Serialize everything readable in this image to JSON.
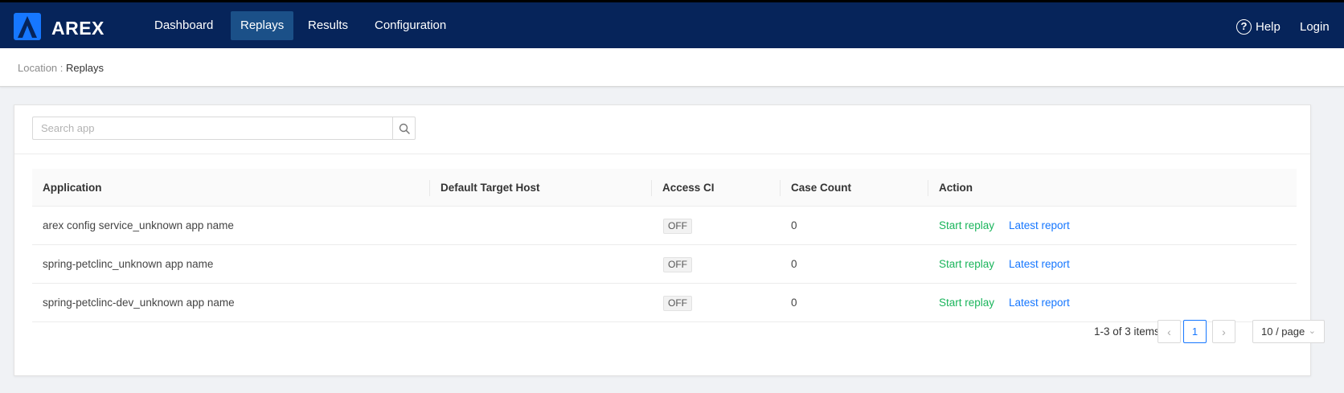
{
  "header": {
    "brand": "AREX",
    "nav": [
      {
        "label": "Dashboard",
        "active": false
      },
      {
        "label": "Replays",
        "active": true
      },
      {
        "label": "Results",
        "active": false
      },
      {
        "label": "Configuration",
        "active": false
      }
    ],
    "help_label": "Help",
    "login_label": "Login",
    "colors": {
      "bar": "#06245a",
      "active_tab": "#1b5088",
      "logo": "#1677ff"
    }
  },
  "breadcrumb": {
    "prefix": "Location : ",
    "current": "Replays"
  },
  "search": {
    "placeholder": "Search app",
    "value": "",
    "icon": "search-icon"
  },
  "table": {
    "columns": [
      "Application",
      "Default Target Host",
      "Access CI",
      "Case Count",
      "Action"
    ],
    "rows": [
      {
        "application": "arex config service_unknown app name",
        "target_host": "",
        "access_ci": "OFF",
        "case_count": "0",
        "start_label": "Start replay",
        "report_label": "Latest report"
      },
      {
        "application": "spring-petclinc_unknown app name",
        "target_host": "",
        "access_ci": "OFF",
        "case_count": "0",
        "start_label": "Start replay",
        "report_label": "Latest report"
      },
      {
        "application": "spring-petclinc-dev_unknown app name",
        "target_host": "",
        "access_ci": "OFF",
        "case_count": "0",
        "start_label": "Start replay",
        "report_label": "Latest report"
      }
    ]
  },
  "pagination": {
    "total_text": "1-3 of 3 items",
    "current_page": "1",
    "page_size": "10 / page",
    "prev_icon": "chevron-left-icon",
    "next_icon": "chevron-right-icon"
  }
}
